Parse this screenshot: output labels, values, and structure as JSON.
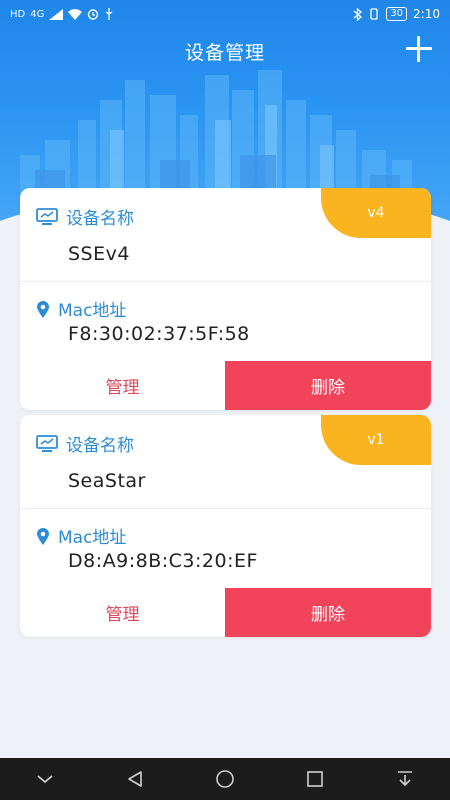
{
  "status_bar": {
    "network_badge": "HD",
    "signal_label": "4G",
    "battery": "30",
    "time": "2:10"
  },
  "header": {
    "title": "设备管理",
    "add_icon": "plus-icon"
  },
  "devices": [
    {
      "version": "v4",
      "name_label": "设备名称",
      "name": "SSEv4",
      "mac_label": "Mac地址",
      "mac": "F8:30:02:37:5F:58",
      "manage_label": "管理",
      "delete_label": "删除"
    },
    {
      "version": "v1",
      "name_label": "设备名称",
      "name": "SeaStar",
      "mac_label": "Mac地址",
      "mac": "D8:A9:8B:C3:20:EF",
      "manage_label": "管理",
      "delete_label": "删除"
    }
  ],
  "colors": {
    "header_blue": "#2b95f2",
    "label_blue": "#2e8cd6",
    "badge_orange": "#f9b420",
    "delete_red": "#f1435a",
    "manage_text": "#e0475a"
  },
  "nav_bar": {
    "icons": [
      "chevron-down-icon",
      "back-triangle-icon",
      "home-circle-icon",
      "recents-square-icon",
      "download-icon"
    ]
  }
}
